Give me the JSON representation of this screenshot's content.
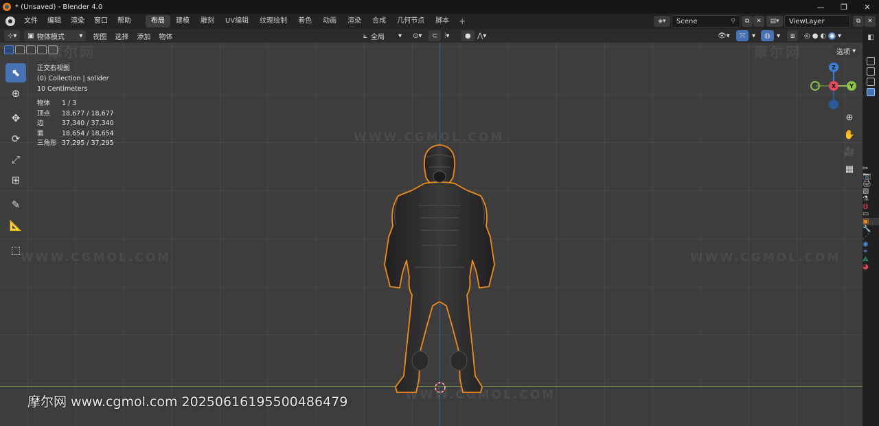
{
  "window": {
    "title": "* (Unsaved) - Blender 4.0",
    "controls": [
      "—",
      "❐",
      "✕"
    ]
  },
  "menubar": {
    "menus": [
      "文件",
      "编辑",
      "渲染",
      "窗口",
      "帮助"
    ],
    "workspaces": [
      "布局",
      "建模",
      "雕刻",
      "UV编辑",
      "纹理绘制",
      "着色",
      "动画",
      "渲染",
      "合成",
      "几何节点",
      "脚本"
    ],
    "add_tab": "+",
    "scene": "Scene",
    "view_layer": "ViewLayer"
  },
  "viewport_header": {
    "mode": "物体模式",
    "menus": [
      "视图",
      "选择",
      "添加",
      "物体"
    ],
    "orientation": "全局",
    "options_button": "选项"
  },
  "overlay": {
    "view_name": "正交右视图",
    "collection": "(0) Collection | solider",
    "grid_scale": "10 Centimeters"
  },
  "stats": [
    {
      "label": "物体",
      "value": "1 / 3"
    },
    {
      "label": "顶点",
      "value": "18,677 / 18,677"
    },
    {
      "label": "边",
      "value": "37,340 / 37,340"
    },
    {
      "label": "面",
      "value": "18,654 / 18,654"
    },
    {
      "label": "三角形",
      "value": "37,295 / 37,295"
    }
  ],
  "gizmo": {
    "x": "X",
    "y": "Y",
    "z": "Z"
  },
  "watermark": {
    "site": "WWW.CGMOL.COM",
    "logo": "摩尔网",
    "footer": "摩尔网 www.cgmol.com 20250616195500486479"
  },
  "colors": {
    "accent": "#4772b3",
    "outline": "#f08a1c",
    "x_axis": "#e84a5f",
    "y_axis": "#8bc34a",
    "z_axis": "#3a7fd8"
  }
}
